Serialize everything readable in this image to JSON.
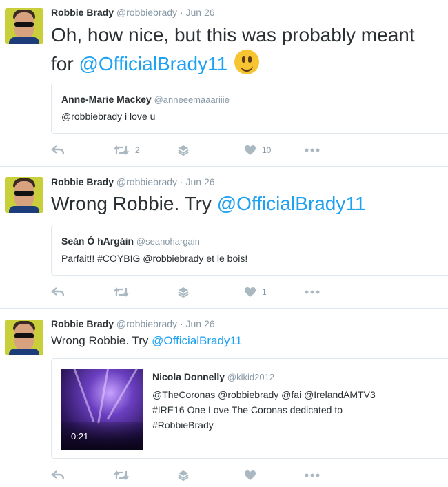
{
  "tweets": [
    {
      "name": "Robbie Brady",
      "handle": "@robbiebrady",
      "date": "Jun 26",
      "text_plain": "Oh, how nice, but this was probably meant",
      "text_prefix": "for ",
      "mention": "@OfficialBrady11",
      "emoji": "smiley-emoji",
      "quote": {
        "name": "Anne-Marie Mackey",
        "handle": "@anneeemaaariiie",
        "text": "@robbiebrady i love u"
      },
      "retweets": "2",
      "likes": "10"
    },
    {
      "name": "Robbie Brady",
      "handle": "@robbiebrady",
      "date": "Jun 26",
      "text_prefix": "Wrong Robbie. Try ",
      "mention": "@OfficialBrady11",
      "quote": {
        "name": "Seán Ó hArgáin",
        "handle": "@seanohargain",
        "text": "Parfait!! #COYBIG @robbiebrady et le bois!"
      },
      "likes": "1"
    },
    {
      "name": "Robbie Brady",
      "handle": "@robbiebrady",
      "date": "Jun 26",
      "text_prefix": "Wrong Robbie. Try ",
      "mention": "@OfficialBrady11",
      "quote": {
        "name": "Nicola Donnelly",
        "handle": "@kikid2012",
        "lines": [
          "@TheCoronas @robbiebrady @fai @IrelandAMTV3",
          "#IRE16 One Love The Coronas dedicated to",
          "#RobbieBrady"
        ],
        "video_duration": "0:21"
      }
    }
  ],
  "separator": "·",
  "colors": {
    "link": "#1da1f2",
    "muted": "#8899a6",
    "icon": "#aab8c2",
    "border": "#e1e8ed"
  }
}
